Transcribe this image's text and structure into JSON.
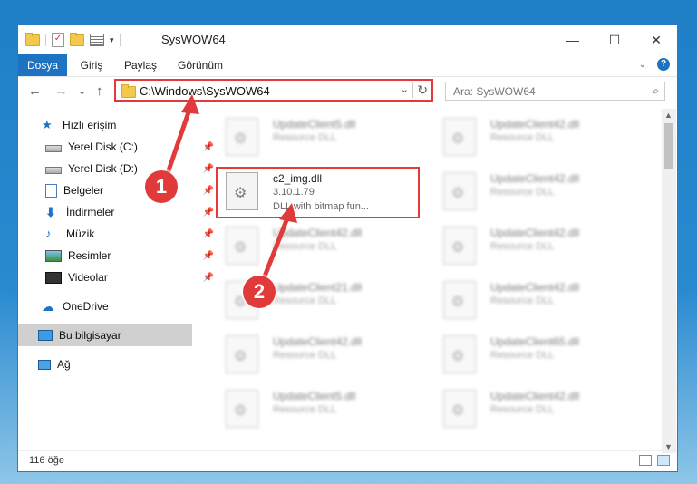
{
  "window": {
    "title": "SysWOW64",
    "buttons": {
      "minimize": "—",
      "maximize": "☐",
      "close": "✕"
    }
  },
  "ribbon": {
    "tabs": [
      "Dosya",
      "Giriş",
      "Paylaş",
      "Görünüm"
    ],
    "active_tab": "Dosya",
    "help": "?"
  },
  "navigation": {
    "back": "←",
    "forward": "→",
    "recent": "⌄",
    "up": "↑",
    "address": "C:\\Windows\\SysWOW64",
    "address_dropdown": "⌄",
    "refresh": "↻",
    "search_placeholder": "Ara: SysWOW64",
    "search_icon": "⌕"
  },
  "sidebar": {
    "items": [
      {
        "label": "Hızlı erişim",
        "icon": "star-icon",
        "pinned": false
      },
      {
        "label": "Yerel Disk (C:)",
        "icon": "disk-icon",
        "pinned": true
      },
      {
        "label": "Yerel Disk (D:)",
        "icon": "disk-icon",
        "pinned": true
      },
      {
        "label": "Belgeler",
        "icon": "document-icon",
        "pinned": true
      },
      {
        "label": "İndirmeler",
        "icon": "download-icon",
        "pinned": true
      },
      {
        "label": "Müzik",
        "icon": "music-icon",
        "pinned": true
      },
      {
        "label": "Resimler",
        "icon": "pictures-icon",
        "pinned": true
      },
      {
        "label": "Videolar",
        "icon": "video-icon",
        "pinned": true
      },
      {
        "label": "OneDrive",
        "icon": "cloud-icon",
        "pinned": false
      },
      {
        "label": "Bu bilgisayar",
        "icon": "computer-icon",
        "pinned": false,
        "selected": true
      },
      {
        "label": "Ağ",
        "icon": "network-icon",
        "pinned": false
      }
    ]
  },
  "files": {
    "left": [
      {
        "name": "UpdateClient5.dll",
        "desc": "Resource DLL"
      },
      {
        "name": "c2_img.dll",
        "version": "3.10.1.79",
        "desc": "DLL with bitmap fun...",
        "highlighted": true
      },
      {
        "name": "UpdateClient42.dll",
        "desc": "Resource DLL"
      },
      {
        "name": "UpdateClient21.dll",
        "desc": "Resource DLL"
      },
      {
        "name": "UpdateClient42.dll",
        "desc": "Resource DLL"
      },
      {
        "name": "UpdateClient5.dll",
        "desc": "Resource DLL"
      }
    ],
    "right": [
      {
        "name": "UpdateClient42.dll",
        "desc": "Resource DLL"
      },
      {
        "name": "UpdateClient42.dll",
        "desc": "Resource DLL"
      },
      {
        "name": "UpdateClient42.dll",
        "desc": "Resource DLL"
      },
      {
        "name": "UpdateClient42.dll",
        "desc": "Resource DLL"
      },
      {
        "name": "UpdateClient65.dll",
        "desc": "Resource DLL"
      },
      {
        "name": "UpdateClient42.dll",
        "desc": "Resource DLL"
      }
    ]
  },
  "status": {
    "count": "116 öğe"
  },
  "callouts": [
    "1",
    "2"
  ],
  "colors": {
    "accent": "#1e72c2",
    "callout": "#e03a3a"
  }
}
